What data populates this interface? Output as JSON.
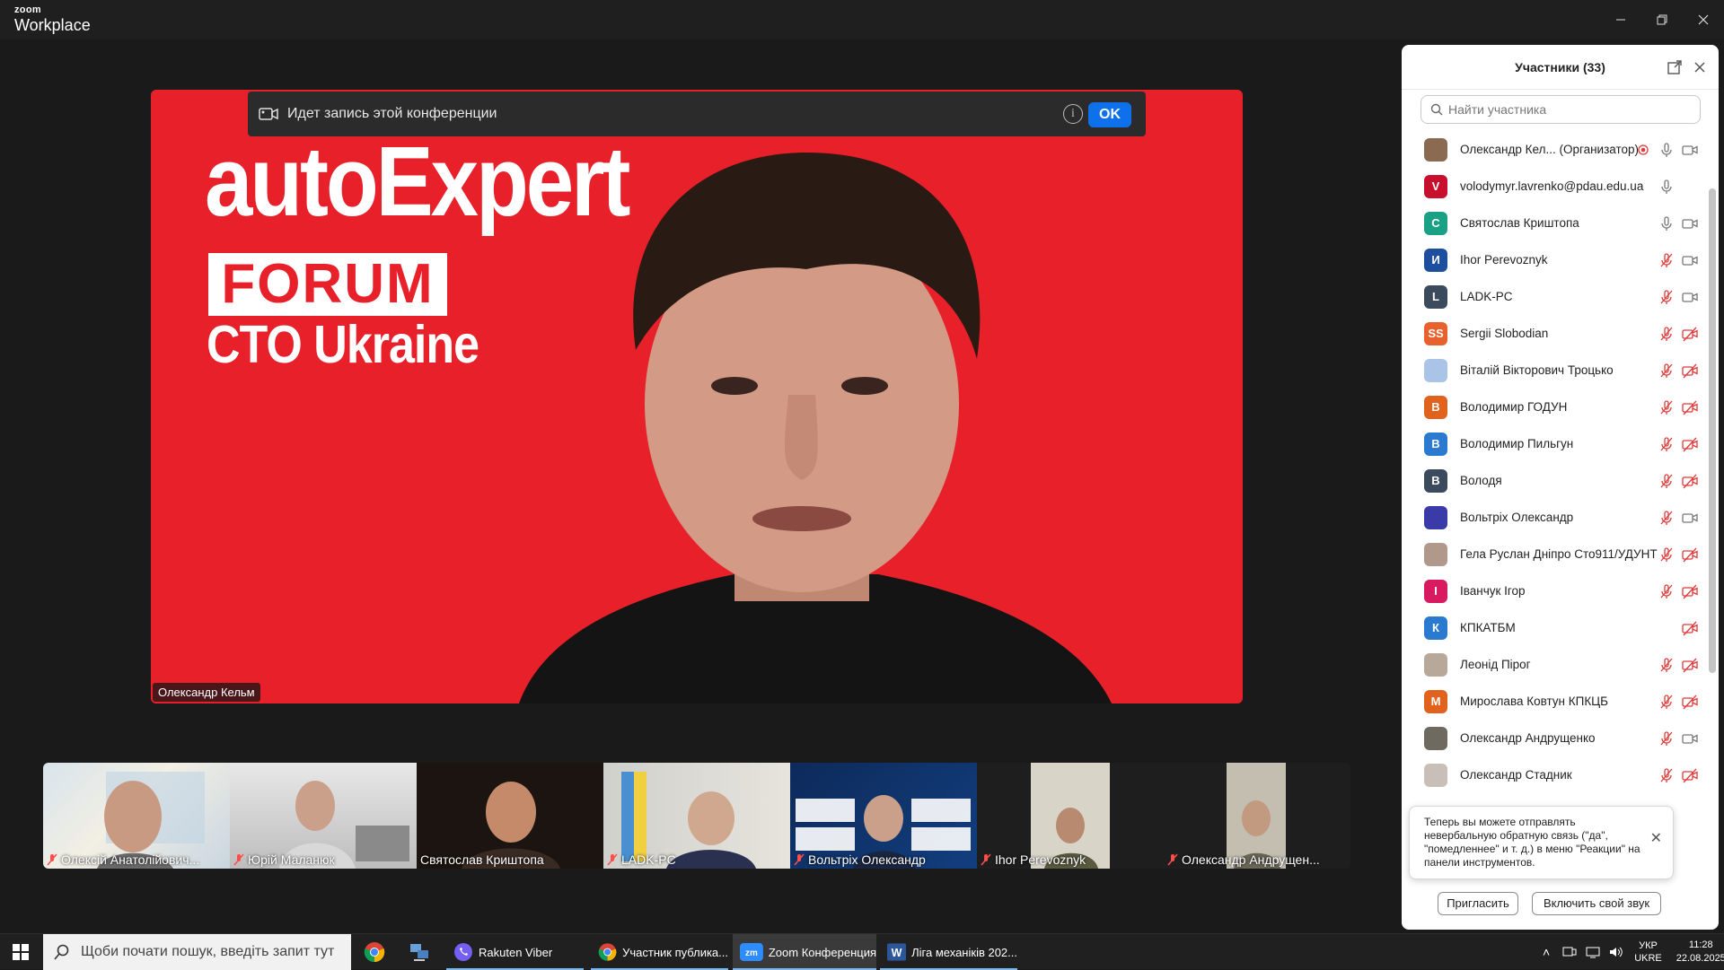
{
  "titlebar": {
    "brand_top": "zoom",
    "brand_bottom": "Workplace"
  },
  "banner": {
    "text": "Идет запись этой конференции",
    "ok_label": "OK"
  },
  "speaker": {
    "name": "Олександр Кельм",
    "logo_line1": "autoExpert",
    "logo_line2": "FORUM",
    "logo_line3": "CTO Ukraine"
  },
  "thumbnails": [
    {
      "name": "Олексій Анатолійович...",
      "muted": true
    },
    {
      "name": "Юрій Маланюк",
      "muted": true
    },
    {
      "name": "Святослав Криштопа",
      "muted": false
    },
    {
      "name": "LADK-PC",
      "muted": true
    },
    {
      "name": "Вольтріх Олександр",
      "muted": true
    },
    {
      "name": "Ihor Perevoznyk",
      "muted": true
    },
    {
      "name": "Олександр Андрущен...",
      "muted": true
    }
  ],
  "panel": {
    "title": "Участники (33)",
    "search_placeholder": "Найти участника",
    "participants": [
      {
        "name": "Олександр Кел...  (Организатор)",
        "avatar": "",
        "color": "#8a6a50",
        "mic": "on",
        "cam": "on",
        "recording": true
      },
      {
        "name": "volodymyr.lavrenko@pdau.edu.ua",
        "avatar": "V",
        "color": "#c8102e",
        "mic": "on",
        "cam": "none"
      },
      {
        "name": "Святослав Криштопа",
        "avatar": "С",
        "color": "#1aa085",
        "mic": "on",
        "cam": "on"
      },
      {
        "name": "Ihor Perevoznyk",
        "avatar": "И",
        "color": "#1d4f9e",
        "mic": "off",
        "cam": "on"
      },
      {
        "name": "LADK-PC",
        "avatar": "L",
        "color": "#3c4a5e",
        "mic": "off",
        "cam": "on"
      },
      {
        "name": "Sergii Slobodian",
        "avatar": "SS",
        "color": "#e8612c",
        "mic": "off",
        "cam": "off"
      },
      {
        "name": "Віталій Вікторович Троцько",
        "avatar": "",
        "color": "#a9c4e6",
        "mic": "off",
        "cam": "off"
      },
      {
        "name": "Володимир ГОДУН",
        "avatar": "В",
        "color": "#e0621d",
        "mic": "off",
        "cam": "off"
      },
      {
        "name": "Володимир Пильгун",
        "avatar": "В",
        "color": "#2a7bd0",
        "mic": "off",
        "cam": "off"
      },
      {
        "name": "Володя",
        "avatar": "В",
        "color": "#3c4a5e",
        "mic": "off",
        "cam": "off"
      },
      {
        "name": "Вольтріх Олександр",
        "avatar": "",
        "color": "#3a3aa8",
        "mic": "off",
        "cam": "on"
      },
      {
        "name": "Гела Руслан Дніпро Сто911/УДУНТ",
        "avatar": "",
        "color": "#b0998a",
        "mic": "off",
        "cam": "off"
      },
      {
        "name": "Іванчук Ігор",
        "avatar": "І",
        "color": "#d81b60",
        "mic": "off",
        "cam": "off"
      },
      {
        "name": "КПКАТБМ",
        "avatar": "К",
        "color": "#2a7bd0",
        "mic": "none",
        "cam": "off"
      },
      {
        "name": "Леонід Пірог",
        "avatar": "",
        "color": "#b8a89a",
        "mic": "off",
        "cam": "off"
      },
      {
        "name": "Мирослава Ковтун КПКЦБ",
        "avatar": "М",
        "color": "#e0621d",
        "mic": "off",
        "cam": "off"
      },
      {
        "name": "Олександр Андрущенко",
        "avatar": "",
        "color": "#6e6a60",
        "mic": "off",
        "cam": "on"
      },
      {
        "name": "Олександр Стадник",
        "avatar": "",
        "color": "#c8c0b8",
        "mic": "off",
        "cam": "off"
      }
    ],
    "toast": "Теперь вы можете отправлять невербальную обратную связь (\"да\", \"помедленнее\" и т. д.) в меню \"Реакции\" на панели инструментов.",
    "invite_label": "Пригласить",
    "unmute_label": "Включить свой звук"
  },
  "taskbar": {
    "search_placeholder": "Щоби почати пошук, введіть запит тут",
    "apps": [
      {
        "label": "Rakuten Viber"
      },
      {
        "label": "Участник публика..."
      },
      {
        "label": "Zoom Конференция"
      },
      {
        "label": "Ліга механіків 202..."
      }
    ],
    "lang_top": "УКР",
    "lang_bottom": "UKRE",
    "time": "11:28",
    "date": "22.08.2025"
  }
}
